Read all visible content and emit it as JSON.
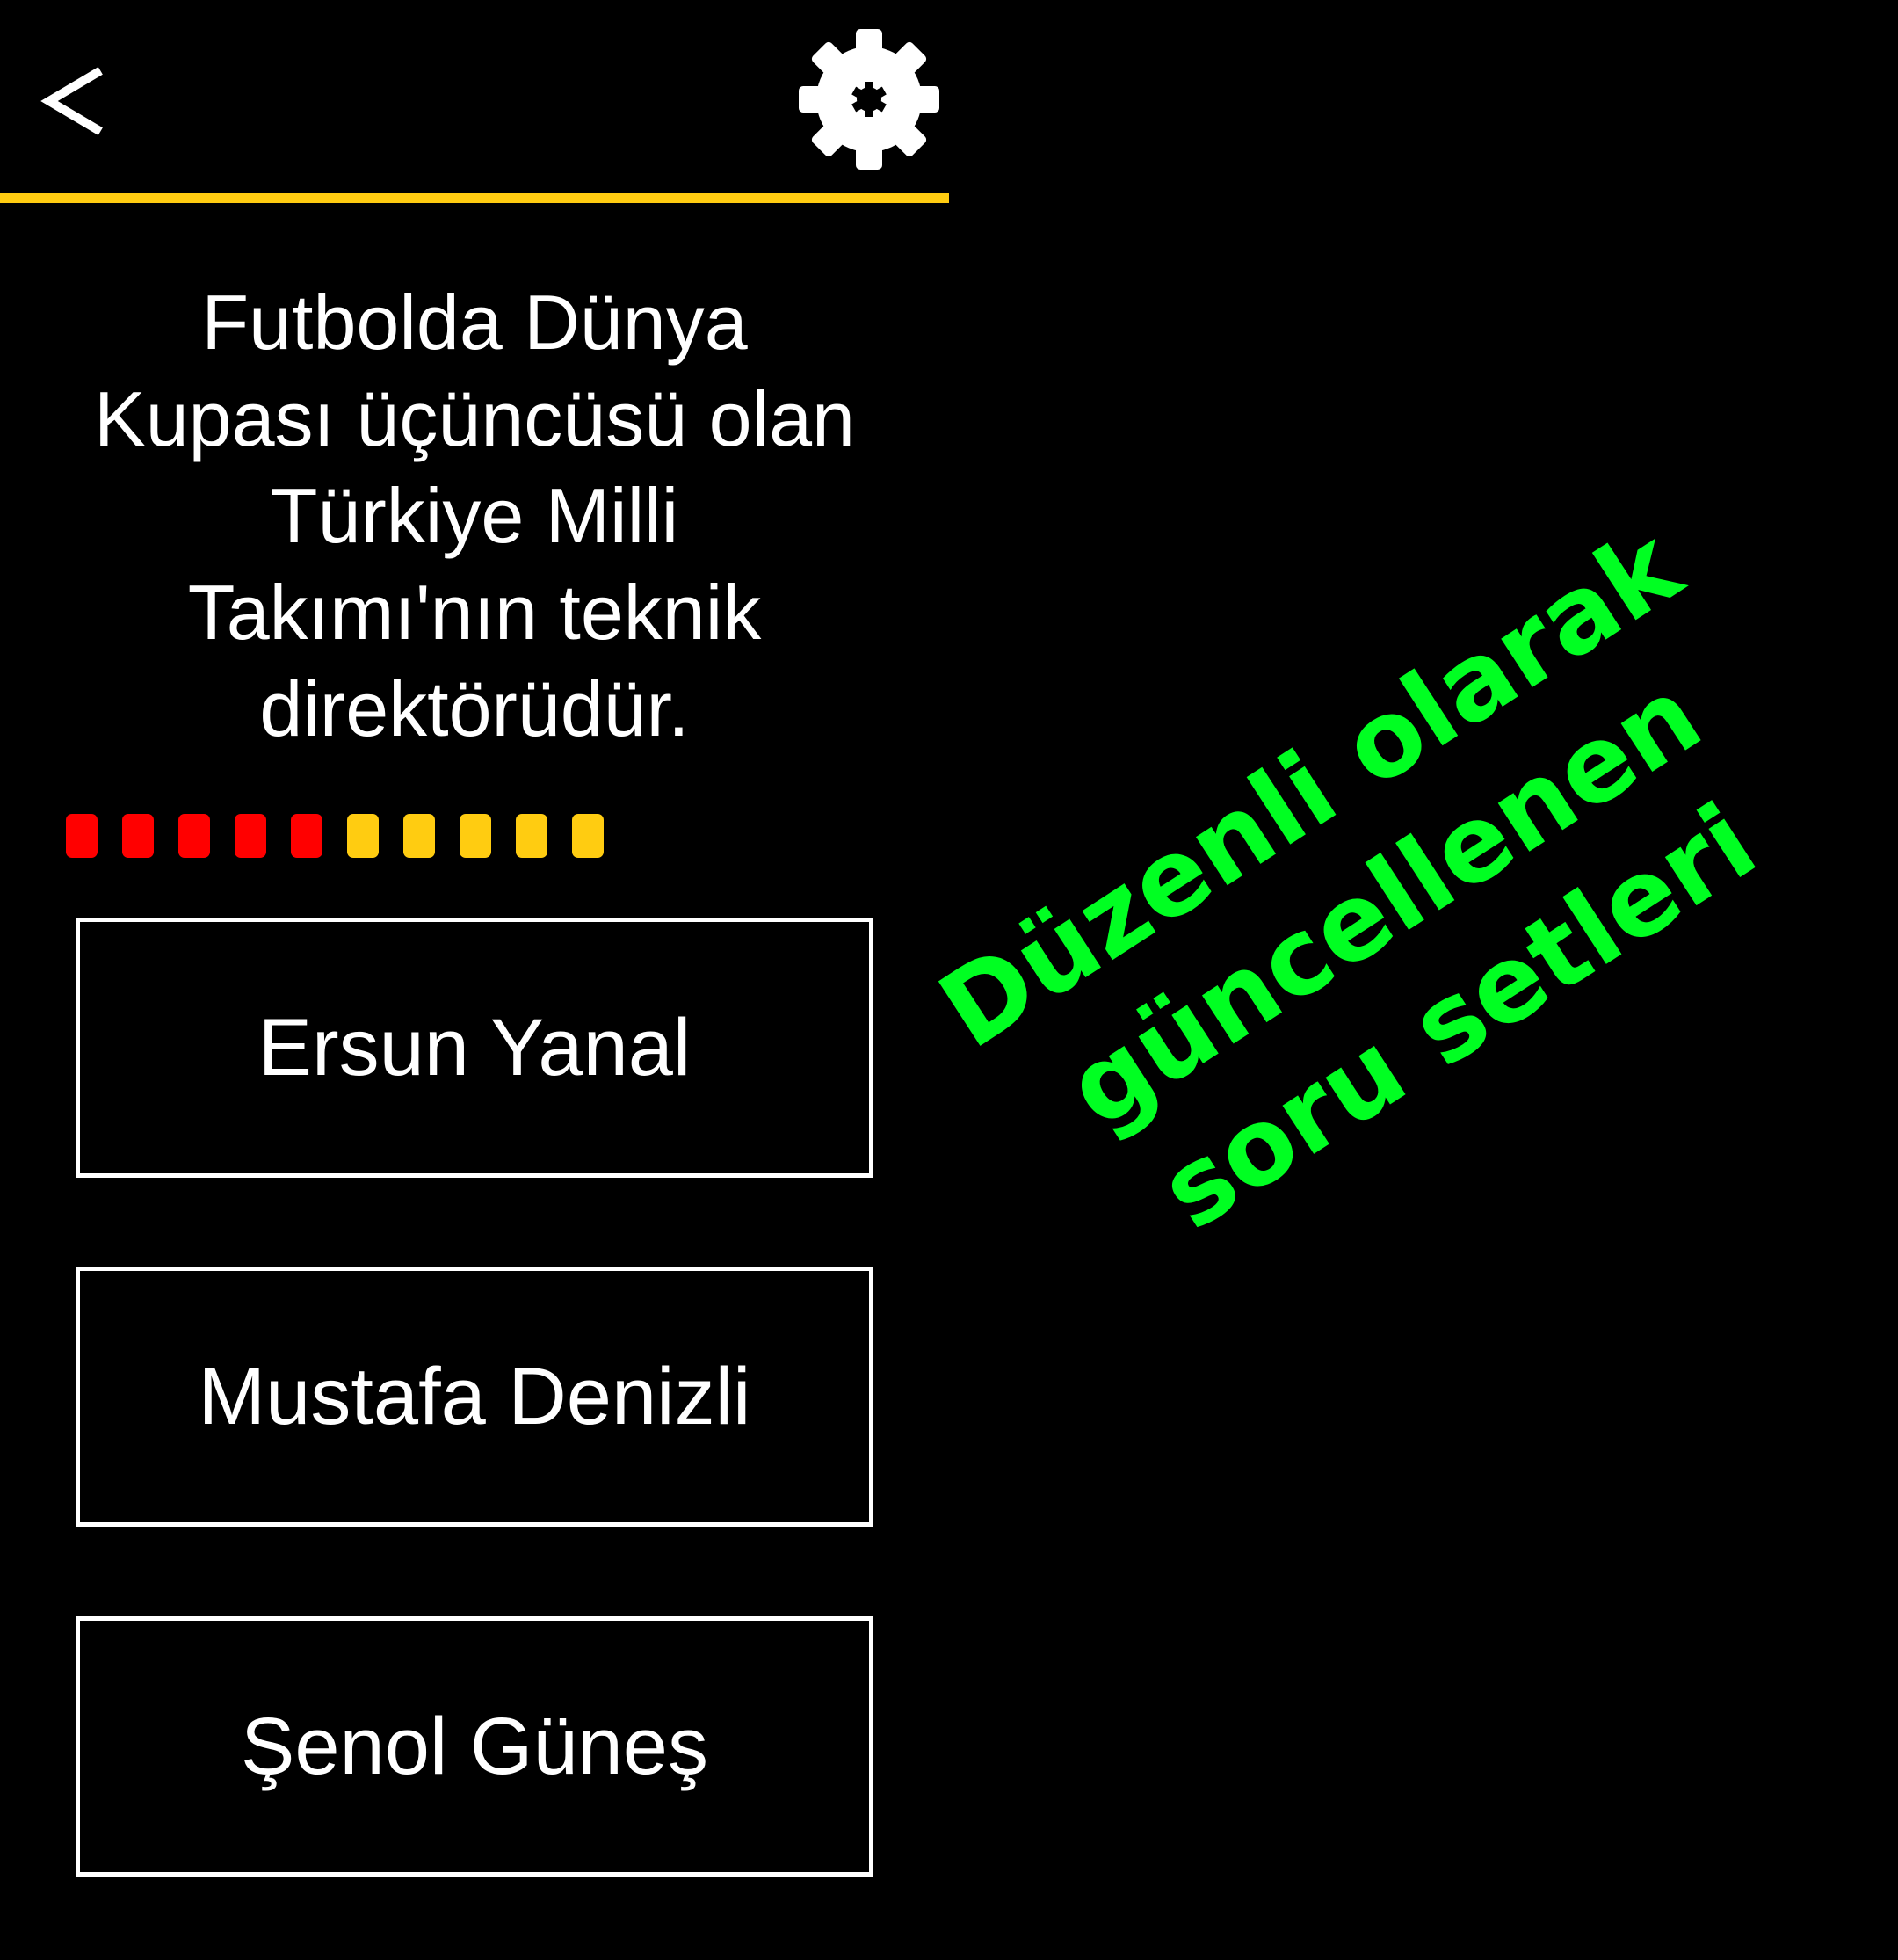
{
  "header": {
    "back_icon": "chevron-left-icon",
    "settings_icon": "gear-icon",
    "divider_color": "#FFCC11"
  },
  "question": {
    "lines": [
      "Futbolda Dünya",
      "Kupası üçüncüsü olan",
      "Türkiye Milli",
      "Takımı'nın teknik",
      "direktörüdür."
    ]
  },
  "progress": {
    "total": 10,
    "remaining_red": 5,
    "colors": {
      "red": "#FF0000",
      "yellow": "#FFCC11"
    }
  },
  "answers": [
    {
      "label": "Ersun Yanal"
    },
    {
      "label": "Mustafa Denizli"
    },
    {
      "label": "Şenol Güneş"
    }
  ],
  "promo": {
    "lines": [
      "Düzenli olarak",
      "güncellenen",
      "soru setleri"
    ],
    "color": "#00FF22"
  }
}
